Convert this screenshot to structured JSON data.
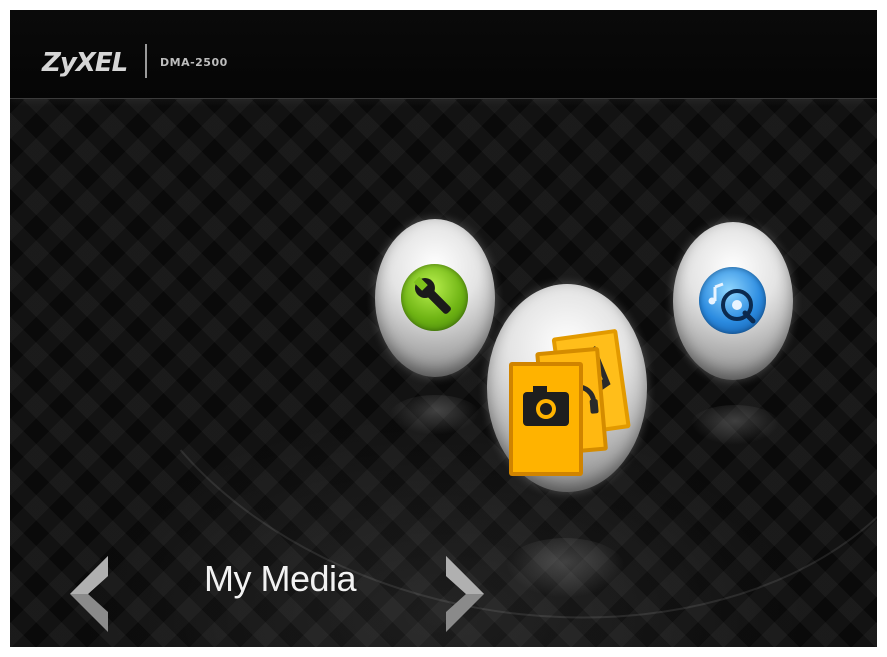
{
  "header": {
    "brand": "ZyXEL",
    "model": "DMA-2500"
  },
  "menu": {
    "selected_label": "My Media",
    "items": [
      {
        "name": "settings",
        "icon": "wrench-icon",
        "color": "#6fb414"
      },
      {
        "name": "my-media",
        "icon": "camera-folder-icon",
        "color": "#f0a800"
      },
      {
        "name": "music",
        "icon": "music-disc-icon",
        "color": "#2b8be0"
      }
    ]
  },
  "colors": {
    "background": "#0b0b0b",
    "label_text": "#f2f2f2"
  }
}
